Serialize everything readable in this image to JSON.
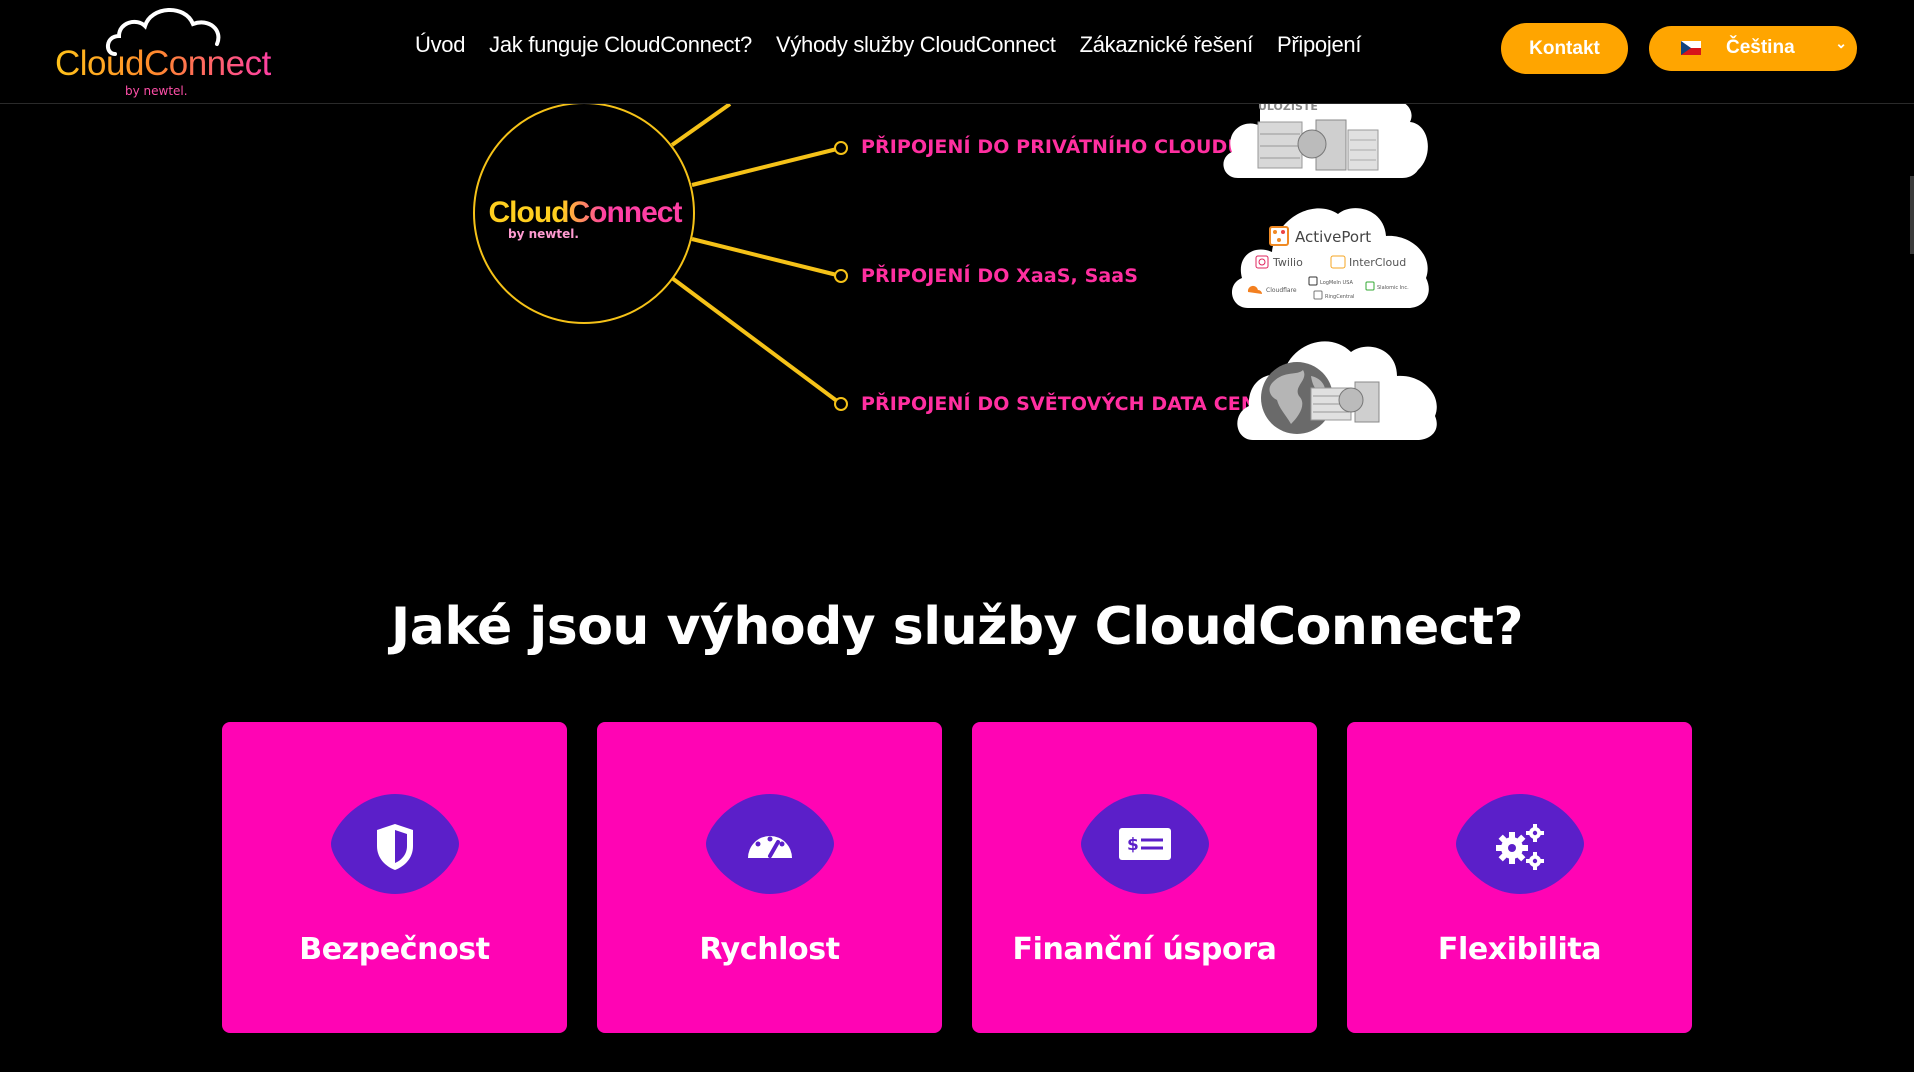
{
  "brand": {
    "name": "CloudConnect",
    "by_line": "by newtel."
  },
  "nav": {
    "items": [
      "Úvod",
      "Jak funguje CloudConnect?",
      "Výhody služby CloudConnect",
      "Zákaznické řešení",
      "Připojení"
    ]
  },
  "header": {
    "contact_label": "Kontakt",
    "language_label": "Čeština"
  },
  "diagram": {
    "hub_name": "CloudConnect",
    "hub_by_line": "by newtel.",
    "connections": [
      "PŘIPOJENÍ DO PRIVÁTNÍHO CLOUDU",
      "PŘIPOJENÍ DO XaaS, SaaS",
      "PŘIPOJENÍ DO SVĚTOVÝCH DATA CENTER"
    ],
    "storage_label": "ÚLOŽIŠTĚ",
    "partners": [
      "ActivePort",
      "Twilio",
      "InterCloud",
      "Cloudflare",
      "LogMeIn USA",
      "RingCentral",
      "Slalomic Inc."
    ]
  },
  "benefits": {
    "heading": "Jaké jsou výhody služby CloudConnect?",
    "items": [
      "Bezpečnost",
      "Rychlost",
      "Finanční úspora",
      "Flexibilita"
    ]
  },
  "colors": {
    "accent_pink": "#ff04b4",
    "accent_orange": "#ffa500",
    "hub_yellow": "#f5c218",
    "badge_purple": "#5b1fc9"
  }
}
